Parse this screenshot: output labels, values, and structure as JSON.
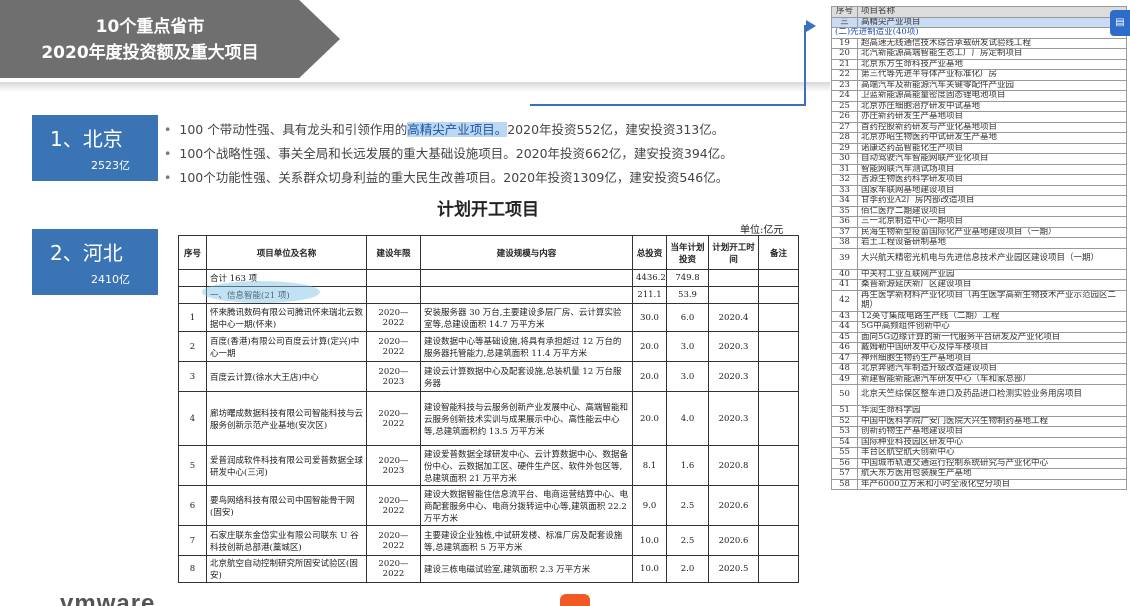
{
  "title": {
    "line1": "10个重点省市",
    "line2": "2020年度投资额及重大项目"
  },
  "provinces": [
    {
      "name": "1、北京",
      "amount": "2523亿"
    },
    {
      "name": "2、河北",
      "amount": "2410亿"
    }
  ],
  "bullets": [
    {
      "pre": "100 个带动性强、具有龙头和引领作用的",
      "hl": "高精尖产业项目。",
      "post": "2020年投资552亿，建安投资313亿。"
    },
    {
      "pre": "100个战略性强、事关全局和长远发展的重大基础设施项目。2020年投资662亿，建安投资394亿。",
      "hl": "",
      "post": ""
    },
    {
      "pre": "100个功能性强、关系群众切身利益的重大民生改善项目。2020年投资1309亿，建安投资546亿。",
      "hl": "",
      "post": ""
    }
  ],
  "plan": {
    "title": "计划开工项目",
    "unit": "单位:亿元",
    "headers": [
      "序号",
      "项目单位及名称",
      "建设年限",
      "建设规模与内容",
      "总投资",
      "当年计划投资",
      "计划开工时间",
      "备注"
    ],
    "summary": {
      "label": "合计 163 项",
      "total": "4436.2",
      "year": "749.8"
    },
    "section": {
      "label": "一、信息智能(21 项)",
      "total": "211.1",
      "year": "53.9"
    },
    "rows": [
      {
        "no": "1",
        "name": "怀来腾讯数码有限公司腾讯怀来瑞北云数据中心一期(怀来)",
        "years": "2020—2022",
        "scope": "安装服务器 30 万台,主要建设多层厂房、云计算实验室等,总建设面积 14.7 万平方米",
        "total": "30.0",
        "year": "6.0",
        "start": "2020.4",
        "note": ""
      },
      {
        "no": "2",
        "name": "百度(香港)有限公司百度云计算(定兴)中心一期",
        "years": "2020—2022",
        "scope": "建设数据中心等基础设施,将具有承担超过 12 万台的服务器托管能力,总建筑面积 11.4 万平方米",
        "total": "20.0",
        "year": "3.0",
        "start": "2020.3",
        "note": ""
      },
      {
        "no": "3",
        "name": "百度云计算(徐水大王店)中心",
        "years": "2020—2023",
        "scope": "建设云计算数据中心及配套设施,总装机量 12 万台服务器",
        "total": "20.0",
        "year": "3.0",
        "start": "2020.3",
        "note": ""
      },
      {
        "no": "4",
        "name": "廊坊曙成数据科技有限公司智能科技与云服务创新示范产业基地(安次区)",
        "years": "2020—2022",
        "scope": "建设智能科技与云服务创新产业发展中心、高端智能和云服务创新技术实训与成果展示中心、高性能云中心等,总建筑面积约 13.5 万平方米",
        "total": "20.0",
        "year": "4.0",
        "start": "2020.3",
        "note": ""
      },
      {
        "no": "5",
        "name": "爱普润成软件科技有限公司爱普数据全球研发中心(三河)",
        "years": "2020—2023",
        "scope": "建设爱普数据全球研发中心、云计算数据中心、数据备份中心、云数据加工区、硬件生产区、软件外包区等,总建筑面积 21 万平方米",
        "total": "8.1",
        "year": "1.6",
        "start": "2020.8",
        "note": ""
      },
      {
        "no": "6",
        "name": "要鸟网络科技有限公司中国智能骨干网(固安)",
        "years": "2020—2022",
        "scope": "建设大数据智能住信息流平台、电商运营结算中心、电商配套服务中心、电商分拨转运中心等,建筑面积 22.2 万平方米",
        "total": "9.0",
        "year": "2.5",
        "start": "2020.6",
        "note": ""
      },
      {
        "no": "7",
        "name": "石家庄联东金岱实业有限公司联东 U 谷科技创新总部港(藁城区)",
        "years": "2020—2022",
        "scope": "主要建设企业独栋,中试研发楼、标准厂房及配套设施等,总建筑面积 5 万平方米",
        "total": "10.0",
        "year": "2.5",
        "start": "2020.6",
        "note": ""
      },
      {
        "no": "8",
        "name": "北京航空自动控制研究所固安试验区(固安)",
        "years": "2020—2022",
        "scope": "建设三栋电磁试验室,建筑面积 2.3 万平方米",
        "total": "10.0",
        "year": "2.0",
        "start": "2020.5",
        "note": ""
      }
    ]
  },
  "right_list": {
    "header": {
      "no": "序号",
      "name": "项目名称"
    },
    "selected": {
      "no": "三",
      "name": "高精尖产业项目"
    },
    "category": "(二)先进制造业(40项)",
    "items": [
      {
        "no": "19",
        "name": "超高速无线通信技术综合承载研发试验线工程"
      },
      {
        "no": "20",
        "name": "北汽新能源高端智能生态工厂厂房定制项目"
      },
      {
        "no": "21",
        "name": "北京东方生命科技产业基地"
      },
      {
        "no": "22",
        "name": "第三代等先进半导体产业标准化厂房"
      },
      {
        "no": "23",
        "name": "高端汽车及新能源汽车关键零配件产业园"
      },
      {
        "no": "24",
        "name": "卫蓝新能源高能量密度固态锂电池项目"
      },
      {
        "no": "25",
        "name": "北京亦庄细胞治疗研发中试基地"
      },
      {
        "no": "26",
        "name": "亦庄新药研发生产基地项目"
      },
      {
        "no": "27",
        "name": "首药控股新药研发与产业化基地项目"
      },
      {
        "no": "28",
        "name": "北京亦昭生物医药中试研发生产基地"
      },
      {
        "no": "29",
        "name": "诺康达药品智能化生产项目"
      },
      {
        "no": "30",
        "name": "自动驾驶汽车智能网联产业化项目"
      },
      {
        "no": "31",
        "name": "智能网联汽车测试场项目"
      },
      {
        "no": "32",
        "name": "吉源生物医药科学研发项目"
      },
      {
        "no": "33",
        "name": "国家车联网基地建设项目"
      },
      {
        "no": "34",
        "name": "甘李药业A2厂房内部改造项目"
      },
      {
        "no": "35",
        "name": "佰仁医疗二期建设项目"
      },
      {
        "no": "36",
        "name": "三一北京制造中心一期项目"
      },
      {
        "no": "37",
        "name": "民海生物新型疫苗国际化产业基地建设项目（一期）"
      },
      {
        "no": "38",
        "name": "岩土工程设备研制基地"
      },
      {
        "no": "39",
        "name": "大兴航天精密光机电与先进信息技术产业园区建设项目（一期）"
      },
      {
        "no": "40",
        "name": "中关村工业互联网产业园"
      },
      {
        "no": "41",
        "name": "桑普新源延庆新厂区建设项目"
      },
      {
        "no": "42",
        "name": "再生医学新材料产业化项目（再生医学高新生物技术产业示范园区二期）"
      },
      {
        "no": "43",
        "name": "12英寸集成电路生产线（二期）工程"
      },
      {
        "no": "44",
        "name": "5G中高频组件创新中心"
      },
      {
        "no": "45",
        "name": "面向5G边缘计算的新一代服务平台研发及产业化项目"
      },
      {
        "no": "46",
        "name": "戴姆勒中国研发中心及停车楼项目"
      },
      {
        "no": "47",
        "name": "神州细胞生物药生产基地项目"
      },
      {
        "no": "48",
        "name": "北京奔驰汽车制造升级改造建设项目"
      },
      {
        "no": "49",
        "name": "新建智能新能源汽车研发中心（车和家总部）"
      },
      {
        "no": "50",
        "name": "北京天竺综保区整车进口及药品进口检测实验业务用房项目"
      },
      {
        "no": "51",
        "name": "华润生命科学园"
      },
      {
        "no": "52",
        "name": "中国中医科学院广安门医院大兴生物制药基地工程"
      },
      {
        "no": "53",
        "name": "创新药物生产基地建设项目"
      },
      {
        "no": "54",
        "name": "国际种业科技园区研发中心"
      },
      {
        "no": "55",
        "name": "丰台区航空航天创新中心"
      },
      {
        "no": "56",
        "name": "中国城市轨道交通运行控制系统研究与产业化中心"
      },
      {
        "no": "57",
        "name": "航天东方医用包装膜生产基地"
      },
      {
        "no": "58",
        "name": "年产6000立方米和小时全液化空分项目"
      }
    ]
  },
  "logo": "vmware",
  "tab_icon": "document-icon"
}
